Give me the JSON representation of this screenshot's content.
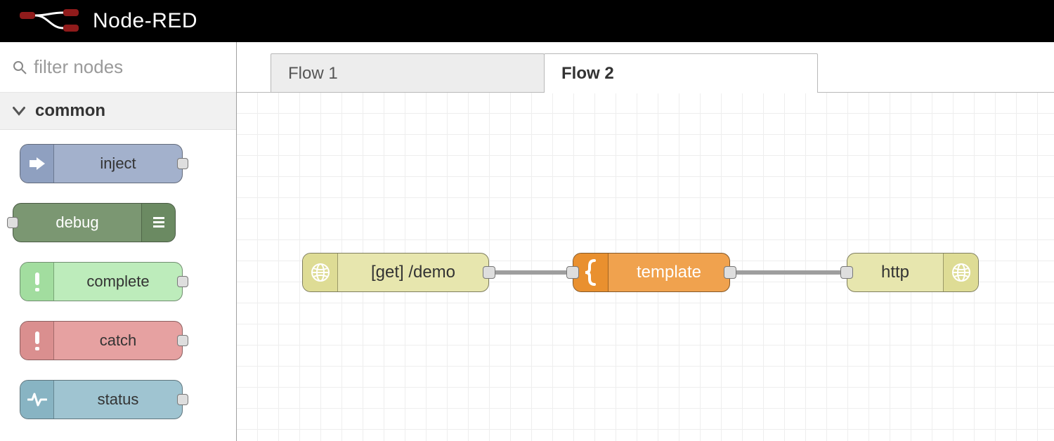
{
  "header": {
    "title": "Node-RED"
  },
  "palette": {
    "filter_placeholder": "filter nodes",
    "category": "common",
    "nodes": [
      {
        "label": "inject"
      },
      {
        "label": "debug"
      },
      {
        "label": "complete"
      },
      {
        "label": "catch"
      },
      {
        "label": "status"
      }
    ]
  },
  "tabs": [
    {
      "label": "Flow 1",
      "active": false
    },
    {
      "label": "Flow 2",
      "active": true
    }
  ],
  "flow_nodes": [
    {
      "label": "[get] /demo"
    },
    {
      "label": "template"
    },
    {
      "label": "http"
    }
  ]
}
